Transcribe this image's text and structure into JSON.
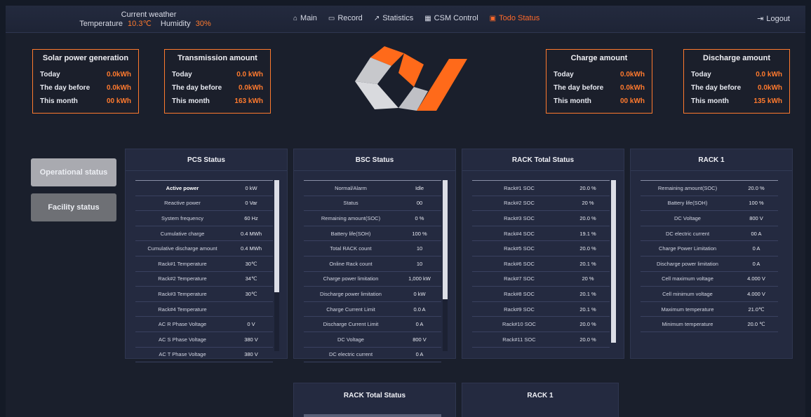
{
  "weather": {
    "title": "Current weather",
    "temperature_label": "Temperature",
    "temperature_value": "10.3℃",
    "humidity_label": "Humidity",
    "humidity_value": "30%"
  },
  "nav": [
    {
      "label": "Main",
      "icon": "home-icon"
    },
    {
      "label": "Record",
      "icon": "monitor-icon"
    },
    {
      "label": "Statistics",
      "icon": "chart-icon"
    },
    {
      "label": "CSM Control",
      "icon": "grid-icon"
    },
    {
      "label": "Todo Status",
      "icon": "alert-icon",
      "active": true
    }
  ],
  "logout_label": "Logout",
  "summaries": [
    {
      "title": "Solar power generation",
      "rows": [
        {
          "label": "Today",
          "value": "0.0kWh"
        },
        {
          "label": "The day before",
          "value": "0.0kWh"
        },
        {
          "label": "This month",
          "value": "00 kWh"
        }
      ]
    },
    {
      "title": "Transmission amount",
      "rows": [
        {
          "label": "Today",
          "value": "0.0 kWh"
        },
        {
          "label": "The day before",
          "value": "0.0kWh"
        },
        {
          "label": "This month",
          "value": "163 kWh"
        }
      ]
    },
    {
      "title": "Charge amount",
      "rows": [
        {
          "label": "Today",
          "value": "0.0kWh"
        },
        {
          "label": "The day before",
          "value": "0.0kWh"
        },
        {
          "label": "This month",
          "value": "00 kWh"
        }
      ]
    },
    {
      "title": "Discharge amount",
      "rows": [
        {
          "label": "Today",
          "value": "0.0 kWh"
        },
        {
          "label": "The day before",
          "value": "0.0kWh"
        },
        {
          "label": "This month",
          "value": "135 kWh"
        }
      ]
    }
  ],
  "side_buttons": [
    "Operational status",
    "Facility status"
  ],
  "panels": [
    {
      "title": "PCS Status",
      "rows": [
        [
          "Active power",
          "0 kW"
        ],
        [
          "Reactive power",
          "0 Var"
        ],
        [
          "System frequency",
          "60 Hz"
        ],
        [
          "Cumulative charge",
          "0.4 MWh"
        ],
        [
          "Cumulative discharge amount",
          "0.4 MWh"
        ],
        [
          "Rack#1 Temperature",
          "30℃"
        ],
        [
          "Rack#2 Temperature",
          "34℃"
        ],
        [
          "Rack#3 Temperature",
          "30℃"
        ],
        [
          "Rack#4 Temperature",
          ""
        ],
        [
          "AC R Phase Voltage",
          "0 V"
        ],
        [
          "AC S Phase Voltage",
          "380 V"
        ],
        [
          "AC T Phase Voltage",
          "380 V"
        ]
      ]
    },
    {
      "title": "BSC Status",
      "rows": [
        [
          "Normal/Alarm",
          "Idle"
        ],
        [
          "Status",
          "00"
        ],
        [
          "Remaining amount(SOC)",
          "0 %"
        ],
        [
          "Battery life(SOH)",
          "100 %"
        ],
        [
          "Total RACK count",
          "10"
        ],
        [
          "Online Rack count",
          "10"
        ],
        [
          "Charge power limitation",
          "1,000 kW"
        ],
        [
          "Discharge power limitation",
          "0 kW"
        ],
        [
          "Charge Current Limit",
          "0.0 A"
        ],
        [
          "Discharge Current Limit",
          "0 A"
        ],
        [
          "DC Voltage",
          "800 V"
        ],
        [
          "DC electric current",
          "0 A"
        ]
      ]
    },
    {
      "title": "RACK Total Status",
      "rows": [
        [
          "Rack#1 SOC",
          "20.0 %"
        ],
        [
          "Rack#2 SOC",
          "20 %"
        ],
        [
          "Rack#3 SOC",
          "20.0 %"
        ],
        [
          "Rack#4 SOC",
          "19.1 %"
        ],
        [
          "Rack#5 SOC",
          "20.0 %"
        ],
        [
          "Rack#6 SOC",
          "20.1 %"
        ],
        [
          "Rack#7 SOC",
          "20 %"
        ],
        [
          "Rack#8 SOC",
          "20.1 %"
        ],
        [
          "Rack#9 SOC",
          "20.1 %"
        ],
        [
          "Rack#10 SOC",
          "20.0 %"
        ],
        [
          "Rack#11 SOC",
          "20.0 %"
        ]
      ]
    },
    {
      "title": "RACK 1",
      "rows": [
        [
          "Remaining amount(SOC)",
          "20.0 %"
        ],
        [
          "Battery life(SOH)",
          "100 %"
        ],
        [
          "DC Voltage",
          "800 V"
        ],
        [
          "DC electric current",
          "00 A"
        ],
        [
          "Charge Power Limitation",
          "0 A"
        ],
        [
          "Discharge power limitation",
          "0 A"
        ],
        [
          "Cell maximum voltage",
          "4.000 V"
        ],
        [
          "Cell minimum voltage",
          "4.000 V"
        ],
        [
          "Maximum temperature",
          "21.0℃"
        ],
        [
          "Minimum temperature",
          "20.0 ℃"
        ]
      ]
    }
  ],
  "lower_panels": [
    "RACK Total Status",
    "RACK 1"
  ]
}
